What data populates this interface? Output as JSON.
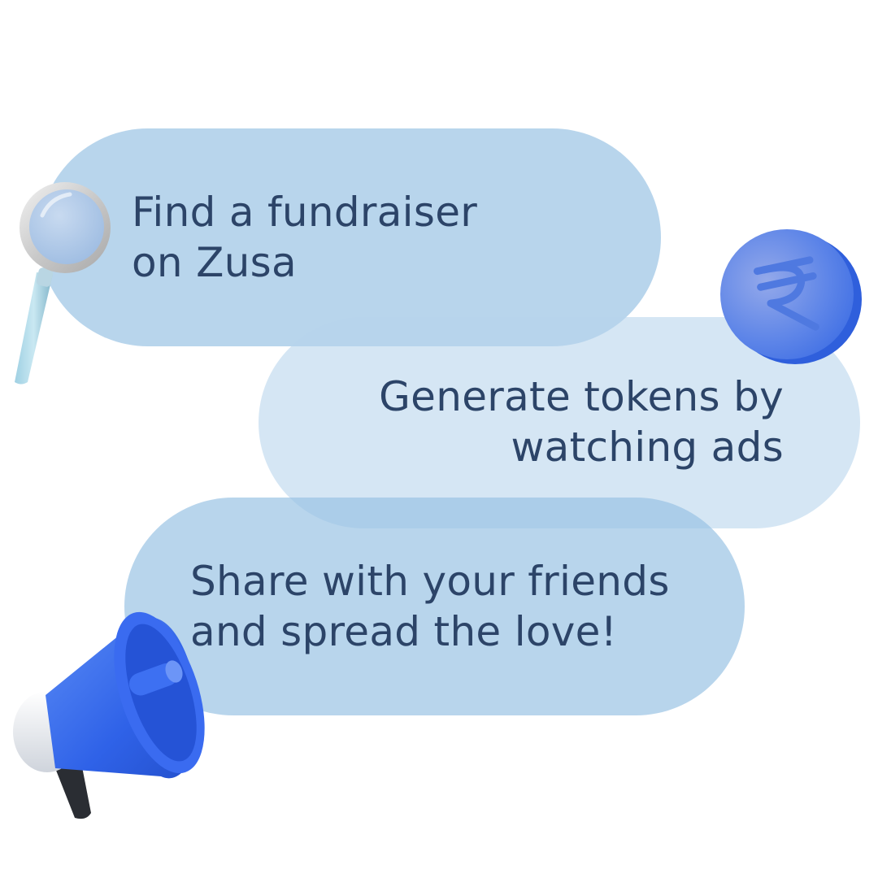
{
  "steps": [
    {
      "lines": [
        "Find a fundraiser",
        "on Zusa"
      ],
      "icon": "magnifying-glass-icon",
      "pill_color": "#96c1e3"
    },
    {
      "lines": [
        "Generate tokens by",
        "watching ads"
      ],
      "icon": "rupee-coin-icon",
      "pill_color": "#b6d4ec"
    },
    {
      "lines": [
        "Share with your friends",
        "and spread the love!"
      ],
      "icon": "megaphone-icon",
      "pill_color": "#96c1e3"
    }
  ],
  "colors": {
    "background": "#ffffff",
    "text": "#2c4468",
    "accent_blue": "#3b6ff0"
  }
}
